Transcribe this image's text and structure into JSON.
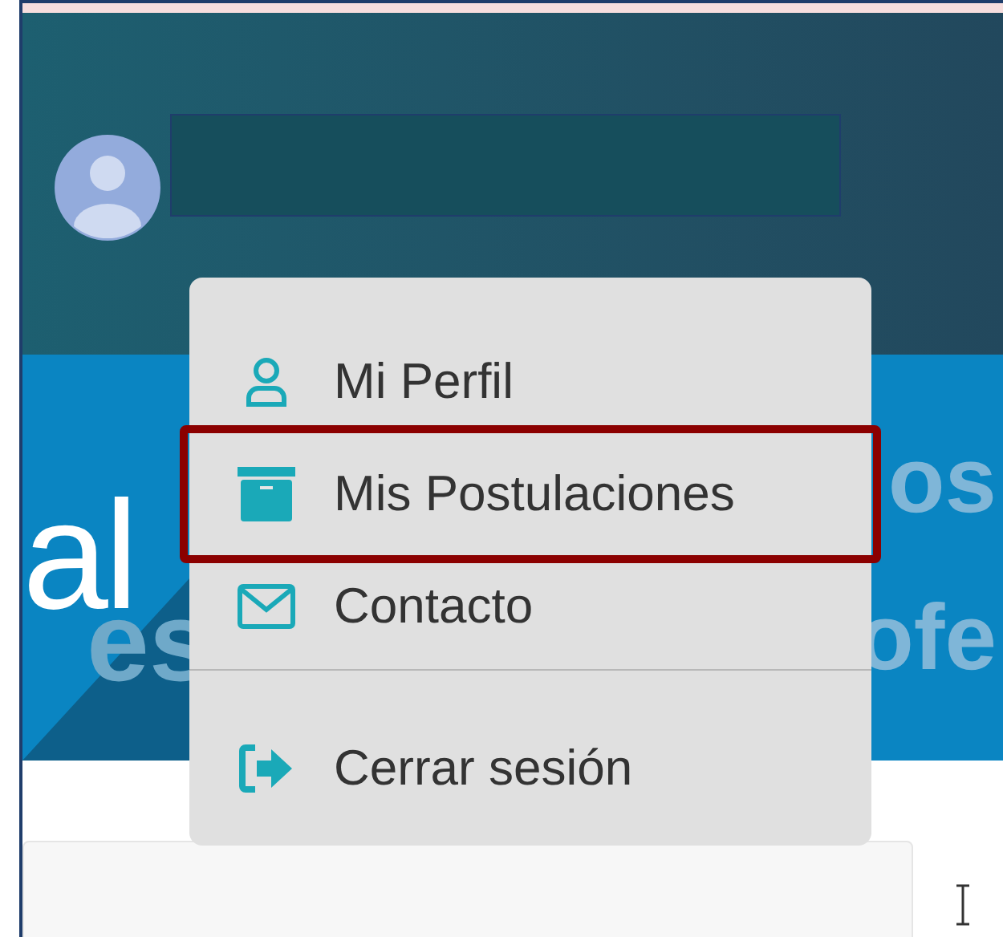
{
  "header": {
    "user_name_redacted": true
  },
  "banner": {
    "left_lines": [
      "al",
      "es"
    ],
    "right_lines": [
      "os",
      "ofe"
    ]
  },
  "menu": {
    "items": [
      {
        "kind": "profile",
        "label": "Mi Perfil",
        "highlighted": false
      },
      {
        "kind": "applications",
        "label": "Mis Postulaciones",
        "highlighted": true
      },
      {
        "kind": "contact",
        "label": "Contacto",
        "highlighted": false
      },
      {
        "kind": "logout",
        "label": "Cerrar sesión",
        "highlighted": false
      }
    ]
  }
}
